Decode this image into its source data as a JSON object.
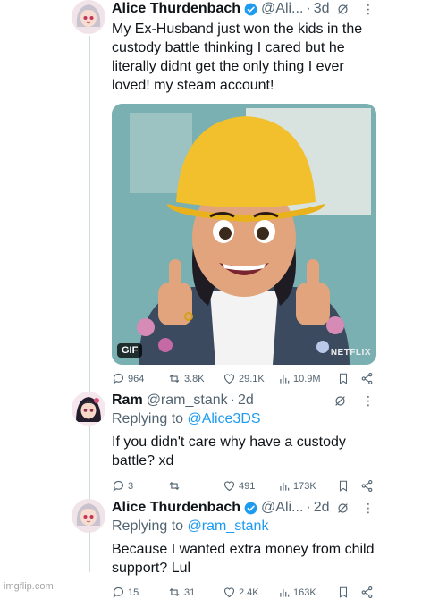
{
  "tweets": [
    {
      "name": "Alice Thurdenbach",
      "handle": "@Ali...",
      "time": "3d",
      "text": "My Ex-Husband just won the kids in the custody battle thinking I cared but he literally didnt get the only thing I ever loved! my steam account!",
      "media": {
        "badge": "GIF",
        "watermark": "NETFLIX"
      },
      "stats": {
        "replies": "964",
        "reposts": "3.8K",
        "likes": "29.1K",
        "views": "10.9M"
      }
    },
    {
      "name": "Ram",
      "handle": "@ram_stank",
      "time": "2d",
      "replying_label": "Replying to",
      "replying_to": "@Alice3DS",
      "text": "If you didn't care why have a custody battle? xd",
      "stats": {
        "replies": "3",
        "reposts": "",
        "likes": "491",
        "views": "173K"
      }
    },
    {
      "name": "Alice Thurdenbach",
      "handle": "@Ali...",
      "time": "2d",
      "replying_label": "Replying to",
      "replying_to": "@ram_stank",
      "text": "Because I wanted extra money from child support? Lul",
      "stats": {
        "replies": "15",
        "reposts": "31",
        "likes": "2.4K",
        "views": "163K"
      }
    }
  ],
  "separator": "·",
  "watermark": "imgflip.com",
  "colors": {
    "link": "#1d9bf0",
    "muted": "#536471",
    "verified": "#1d9bf0"
  }
}
